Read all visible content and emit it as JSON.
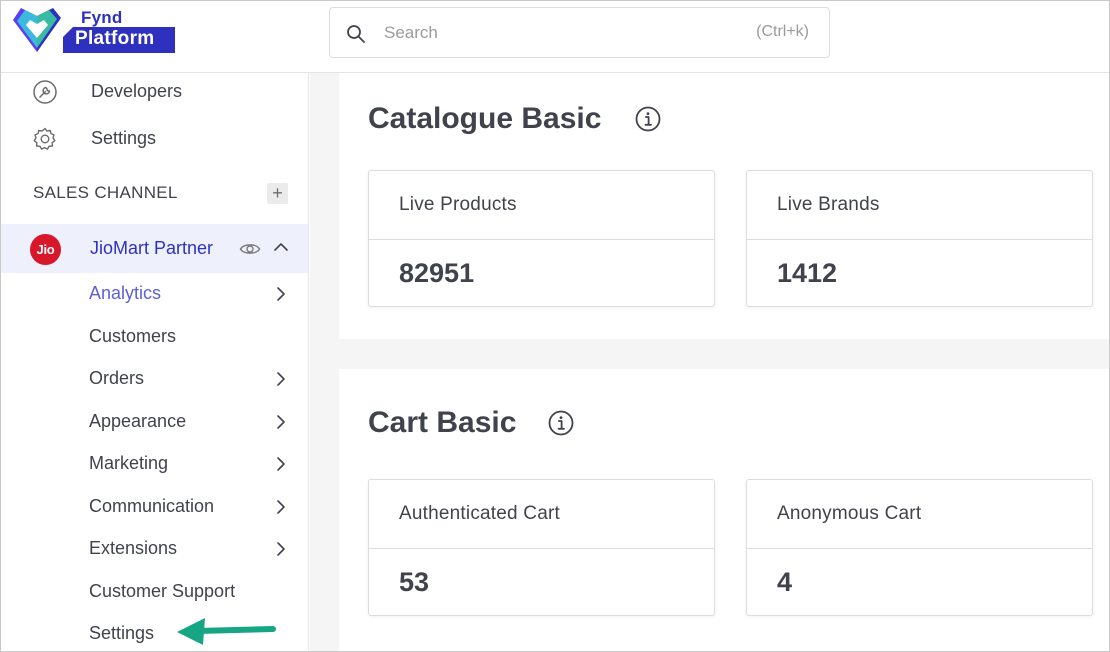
{
  "brand": {
    "logo_top": "Fynd",
    "logo_bottom": "Platform"
  },
  "search": {
    "placeholder": "Search",
    "shortcut": "(Ctrl+k)"
  },
  "sidebar": {
    "top_items": [
      {
        "label": "Developers",
        "icon": "developers-icon"
      },
      {
        "label": "Settings",
        "icon": "gear-icon"
      }
    ],
    "section_title": "SALES CHANNEL",
    "add_label": "+",
    "channel": {
      "badge": "Jio",
      "label": "JioMart Partner",
      "badge_color": "#d6182a"
    },
    "sub_items": [
      {
        "label": "Analytics",
        "active": true,
        "has_chevron": true
      },
      {
        "label": "Customers",
        "active": false,
        "has_chevron": false
      },
      {
        "label": "Orders",
        "active": false,
        "has_chevron": true
      },
      {
        "label": "Appearance",
        "active": false,
        "has_chevron": true
      },
      {
        "label": "Marketing",
        "active": false,
        "has_chevron": true
      },
      {
        "label": "Communication",
        "active": false,
        "has_chevron": true
      },
      {
        "label": "Extensions",
        "active": false,
        "has_chevron": true
      },
      {
        "label": "Customer Support",
        "active": false,
        "has_chevron": false
      },
      {
        "label": "Settings",
        "active": false,
        "has_chevron": false
      }
    ]
  },
  "main": {
    "panels": [
      {
        "title": "Catalogue Basic",
        "cards": [
          {
            "label": "Live Products",
            "value": "82951"
          },
          {
            "label": "Live Brands",
            "value": "1412"
          }
        ]
      },
      {
        "title": "Cart Basic",
        "cards": [
          {
            "label": "Authenticated Cart",
            "value": "53"
          },
          {
            "label": "Anonymous Cart",
            "value": "4"
          }
        ]
      }
    ]
  },
  "colors": {
    "accent": "#2e31be",
    "active_text": "#5c5fd6",
    "active_bg": "#eef0fb",
    "arrow": "#17a683"
  }
}
